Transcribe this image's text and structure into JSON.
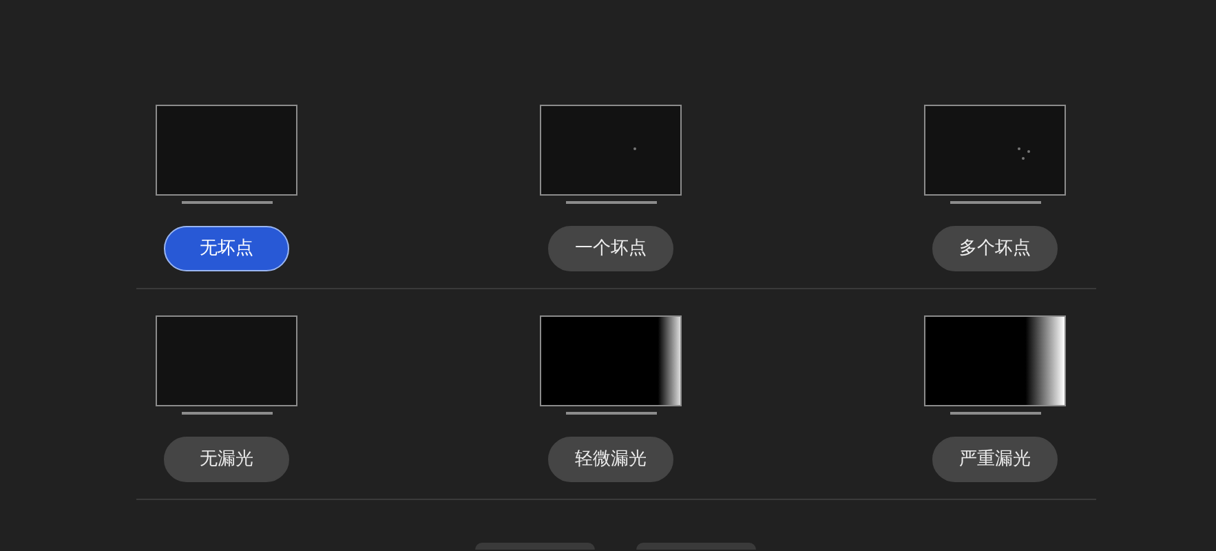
{
  "sections": [
    {
      "items": [
        {
          "label": "无坏点",
          "selected": true,
          "kind": "clean"
        },
        {
          "label": "一个坏点",
          "selected": false,
          "kind": "dot"
        },
        {
          "label": "多个坏点",
          "selected": false,
          "kind": "dots"
        }
      ]
    },
    {
      "items": [
        {
          "label": "无漏光",
          "selected": false,
          "kind": "dark"
        },
        {
          "label": "轻微漏光",
          "selected": false,
          "kind": "slight"
        },
        {
          "label": "严重漏光",
          "selected": false,
          "kind": "heavy"
        }
      ]
    }
  ]
}
